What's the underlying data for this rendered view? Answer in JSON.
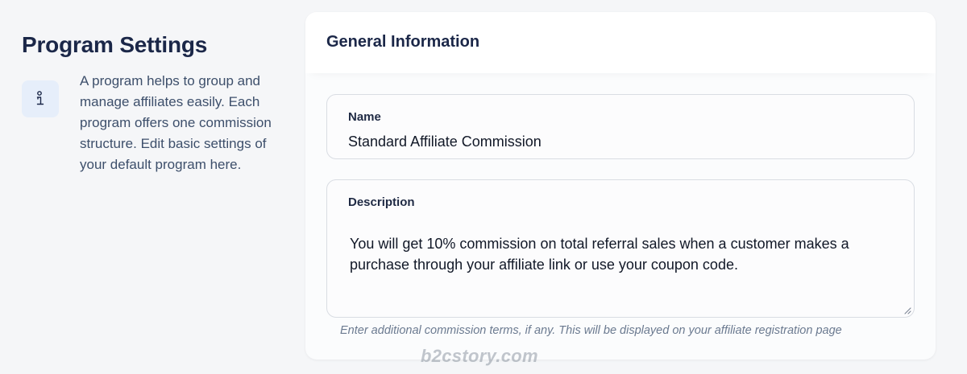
{
  "sidebar": {
    "title": "Program Settings",
    "info_icon": "info-icon",
    "description": "A program helps to group and manage affiliates easily. Each program offers one commission structure. Edit basic settings of your default program here."
  },
  "card": {
    "title": "General Information",
    "name_field": {
      "label": "Name",
      "value": "Standard Affiliate Commission"
    },
    "description_field": {
      "label": "Description",
      "value": "You will get 10% commission on total referral sales when a customer makes a purchase through your affiliate link or use your coupon code.",
      "help_text": "Enter additional commission terms, if any. This will be displayed on your affiliate registration page"
    }
  },
  "watermark": "b2cstory.com",
  "colors": {
    "accent_bg": "#e6eefa",
    "title": "#1b2748"
  }
}
